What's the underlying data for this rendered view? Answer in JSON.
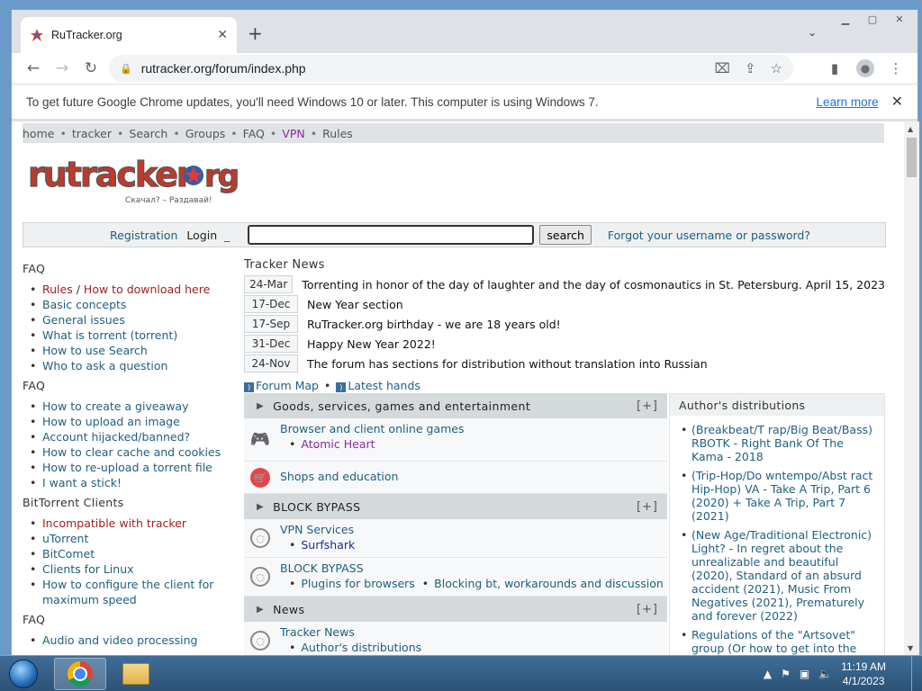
{
  "browser": {
    "tab_title": "RuTracker.org",
    "url": "rutracker.org/forum/index.php",
    "infobar": {
      "message": "To get future Google Chrome updates, you'll need Windows 10 or later. This computer is using Windows 7.",
      "learn_more": "Learn more"
    }
  },
  "site": {
    "topnav": [
      "home",
      "tracker",
      "Search",
      "Groups",
      "FAQ",
      "VPN",
      "Rules"
    ],
    "logo_tagline": "Скачал? – Раздавай!",
    "login": {
      "registration": "Registration",
      "login": "Login",
      "underscore": "_",
      "search_button": "search",
      "forgot": "Forgot your username or password?"
    },
    "left": {
      "faq1": "FAQ",
      "rules": "Rules",
      "slash": "/",
      "how_download": "How to download here",
      "basic": "Basic concepts",
      "general": "General issues",
      "what_torrent": "What is torrent (torrent)",
      "use_search": "How to use Search",
      "who_ask": "Who to ask a question",
      "faq2": "FAQ",
      "giveaway": "How to create a giveaway",
      "upload_image": "How to upload an image",
      "hijacked": "Account hijacked/banned?",
      "clear_cache": "How to clear cache and cookies",
      "reupload": "How to re-upload a torrent file",
      "stick": "I want a stick!",
      "bt_head": "BitTorrent Clients",
      "incompatible": "Incompatible with tracker",
      "utorrent": "uTorrent",
      "bitcomet": "BitComet",
      "linux": "Clients for Linux",
      "configure": "How to configure the client for maximum speed",
      "faq3": "FAQ",
      "audio": "Audio and video processing"
    },
    "news": {
      "head": "Tracker News",
      "items": [
        {
          "date": "24-Mar",
          "text": "Torrenting in honor of the day of laughter and the day of cosmonautics in St. Petersburg. April 15, 2023"
        },
        {
          "date": "17-Dec",
          "text": "New Year section"
        },
        {
          "date": "17-Sep",
          "text": "RuTracker.org birthday - we are 18 years old!"
        },
        {
          "date": "31-Dec",
          "text": "Happy New Year 2022!"
        },
        {
          "date": "24-Nov",
          "text": "The forum has sections for distribution without translation into Russian"
        }
      ],
      "forum_map": "Forum Map",
      "bullet": "•",
      "latest": "Latest hands"
    },
    "forum": {
      "plus": "[+]",
      "cat1": "Goods, services, games and entertainment",
      "games": "Browser and client online games",
      "atomic": "Atomic Heart",
      "shops": "Shops and education",
      "cat2": "BLOCK BYPASS",
      "vpn_services": "VPN Services",
      "surfshark": "Surfshark",
      "block_bypass": "BLOCK BYPASS",
      "plugins": "Plugins for browsers",
      "blocking": "Blocking bt, workarounds and discussion",
      "cat3": "News",
      "tracker_news": "Tracker News",
      "authors": "Author's distributions"
    },
    "right": {
      "head": "Author's distributions",
      "items": [
        "(Breakbeat/T rap/Big Beat/Bass) RBOTK - Right Bank Of The Kama - 2018",
        "(Trip-Hop/Do wntempo/Abst ract Hip-Hop) VA - Take A Trip, Part 6 (2020) + Take A Trip, Part 7 (2021)",
        "(New Age/Traditional Electronic) Light? - In regret about the unrealizable and beautiful (2020), Standard of an absurd accident (2021), Music From Negatives (2021), Prematurely and forever (2022)",
        "Regulations of the \"Artsovet\" group (Or how to get into the"
      ]
    }
  },
  "taskbar": {
    "time": "11:19 AM",
    "date": "4/1/2023"
  }
}
